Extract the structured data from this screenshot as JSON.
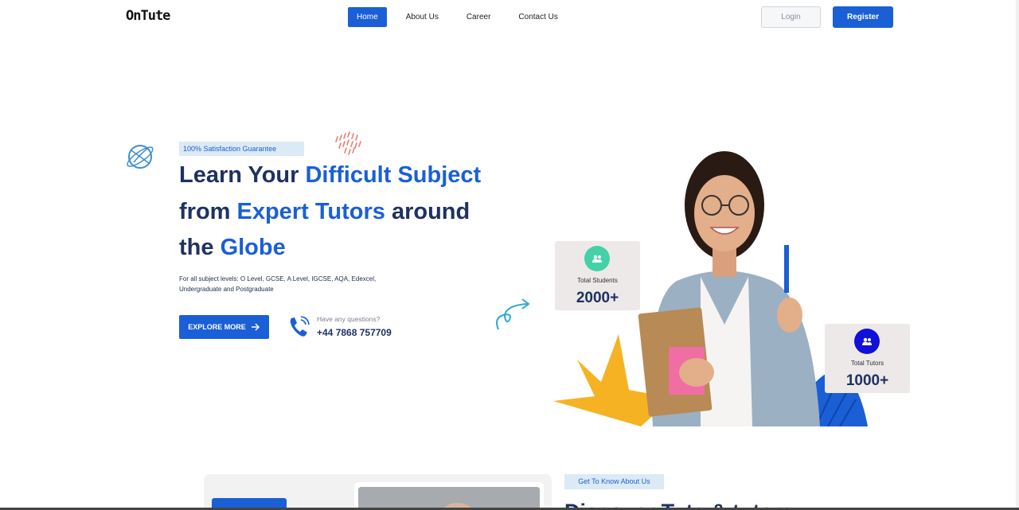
{
  "nav": {
    "logo": "OnTute",
    "links": [
      {
        "label": "Home",
        "active": true
      },
      {
        "label": "About Us",
        "active": false
      },
      {
        "label": "Career",
        "active": false
      },
      {
        "label": "Contact Us",
        "active": false
      }
    ],
    "login_label": "Login",
    "register_label": "Register"
  },
  "hero": {
    "badge": "100% Satisfaction Guarantee",
    "headline": {
      "part1": "Learn Your ",
      "highlight1": "Difficult Subject",
      "part2": "from ",
      "highlight2": "Expert Tutors",
      "part3": " around",
      "part4": "the ",
      "highlight3": "Globe"
    },
    "subtext": "For all subject levels: O Level, GCSE, A Level, IGCSE, AQA, Edexcel, Undergraduate and Postgraduate",
    "explore_label": "EXPLORE MORE",
    "question_label": "Have any questions?",
    "phone": "+44 7868 757709"
  },
  "stats": {
    "students": {
      "label": "Total Students",
      "value": "2000+"
    },
    "tutors": {
      "label": "Total Tutors",
      "value": "1000+"
    }
  },
  "about": {
    "badge": "Get To Know About Us",
    "heading": "Discover Tute & tutors"
  },
  "colors": {
    "primary": "#1a5fd6",
    "navy": "#1f3160",
    "badge_bg": "#dceaf6",
    "students_circle": "#44d1a8",
    "tutors_circle": "#1010d8",
    "starburst": "#f5b324"
  },
  "icons": [
    "globe-icon",
    "phone-icon",
    "arrow-right-icon",
    "users-icon",
    "swirl-arrow-icon"
  ]
}
